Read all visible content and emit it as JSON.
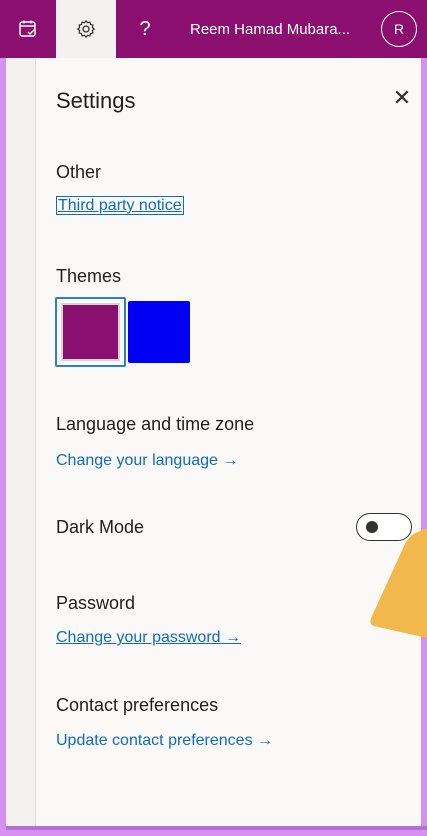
{
  "topbar": {
    "user_name": "Reem Hamad Mubara...",
    "avatar_initial": "R",
    "help_glyph": "?",
    "icons": [
      "calendar-check-icon",
      "gear-icon",
      "help-icon"
    ],
    "color": "#8a0f6f"
  },
  "panel": {
    "title": "Settings",
    "close_glyph": "✕"
  },
  "sections": {
    "other": {
      "heading": "Other",
      "link": "Third party notice"
    },
    "themes": {
      "heading": "Themes",
      "swatches": [
        {
          "color": "#8b0f70",
          "selected": true
        },
        {
          "color": "#0000f5",
          "selected": false
        }
      ]
    },
    "language": {
      "heading": "Language and time zone",
      "link": "Change your language",
      "arrow": "→"
    },
    "dark_mode": {
      "heading": "Dark Mode",
      "enabled": false
    },
    "password": {
      "heading": "Password",
      "link": "Change your password",
      "arrow": "→"
    },
    "contact": {
      "heading": "Contact preferences",
      "link": "Update contact preferences",
      "arrow": "→"
    }
  },
  "colors": {
    "accent": "#0f6cbd",
    "annotation_arrow": "#f2b84b"
  }
}
